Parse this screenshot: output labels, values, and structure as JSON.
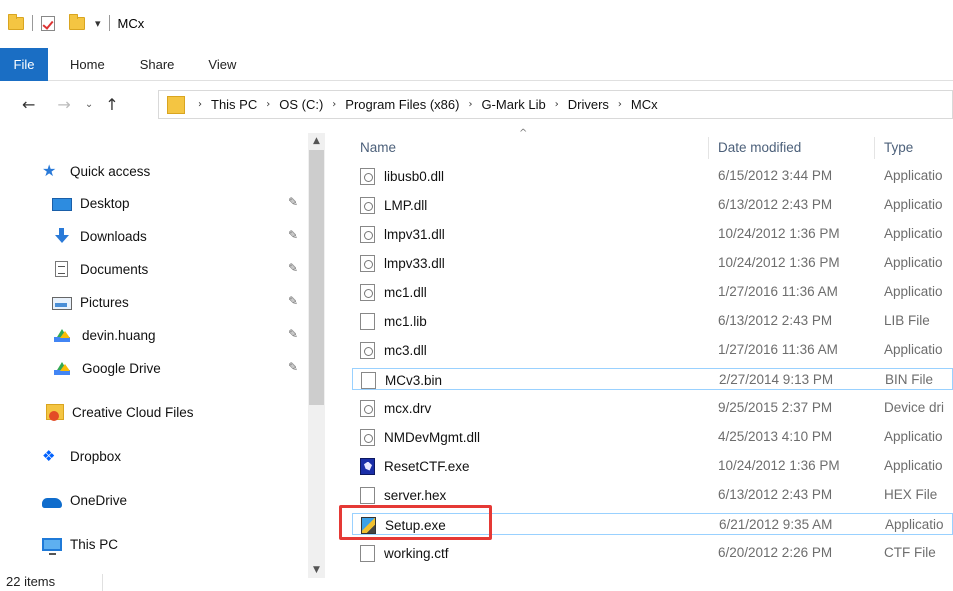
{
  "window": {
    "title": "MCx"
  },
  "quick_access": {
    "dropdown_glyph": "▾"
  },
  "ribbon": {
    "tabs": [
      {
        "label": "File",
        "active": true
      },
      {
        "label": "Home"
      },
      {
        "label": "Share"
      },
      {
        "label": "View"
      }
    ]
  },
  "navigation": {
    "back_glyph": "←",
    "forward_glyph": "→",
    "recent_glyph": "⌄",
    "up_glyph": "↑",
    "breadcrumb": [
      "This PC",
      "OS (C:)",
      "Program Files (x86)",
      "G-Mark Lib",
      "Drivers",
      "MCx"
    ],
    "separator": "›"
  },
  "nav_pane": {
    "items": [
      {
        "label": "Quick access",
        "icon": "star-icon"
      },
      {
        "label": "Desktop",
        "icon": "desktop-icon",
        "pinned": true
      },
      {
        "label": "Downloads",
        "icon": "downloads-icon",
        "pinned": true
      },
      {
        "label": "Documents",
        "icon": "documents-icon",
        "pinned": true
      },
      {
        "label": "Pictures",
        "icon": "pictures-icon",
        "pinned": true
      },
      {
        "label": "devin.huang",
        "icon": "google-drive-icon",
        "pinned": true
      },
      {
        "label": "Google Drive",
        "icon": "google-drive-icon",
        "pinned": true
      },
      {
        "label": "Creative Cloud Files",
        "icon": "creative-cloud-icon"
      },
      {
        "label": "Dropbox",
        "icon": "dropbox-icon"
      },
      {
        "label": "OneDrive",
        "icon": "onedrive-icon"
      },
      {
        "label": "This PC",
        "icon": "this-pc-icon"
      }
    ],
    "pin_glyph": "✎"
  },
  "file_list": {
    "columns": {
      "name": "Name",
      "date": "Date modified",
      "type": "Type"
    },
    "sort_glyph": "^",
    "files": [
      {
        "name": "libusb0.dll",
        "date": "6/15/2012 3:44 PM",
        "type": "Applicatio",
        "icon": "dll-icon"
      },
      {
        "name": "LMP.dll",
        "date": "6/13/2012 2:43 PM",
        "type": "Applicatio",
        "icon": "dll-icon"
      },
      {
        "name": "lmpv31.dll",
        "date": "10/24/2012 1:36 PM",
        "type": "Applicatio",
        "icon": "dll-icon"
      },
      {
        "name": "lmpv33.dll",
        "date": "10/24/2012 1:36 PM",
        "type": "Applicatio",
        "icon": "dll-icon"
      },
      {
        "name": "mc1.dll",
        "date": "1/27/2016 11:36 AM",
        "type": "Applicatio",
        "icon": "dll-icon"
      },
      {
        "name": "mc1.lib",
        "date": "6/13/2012 2:43 PM",
        "type": "LIB File",
        "icon": "file-icon"
      },
      {
        "name": "mc3.dll",
        "date": "1/27/2016 11:36 AM",
        "type": "Applicatio",
        "icon": "dll-icon"
      },
      {
        "name": "MCv3.bin",
        "date": "2/27/2014 9:13 PM",
        "type": "BIN File",
        "icon": "file-icon",
        "selected": true
      },
      {
        "name": "mcx.drv",
        "date": "9/25/2015 2:37 PM",
        "type": "Device dri",
        "icon": "dll-icon"
      },
      {
        "name": "NMDevMgmt.dll",
        "date": "4/25/2013 4:10 PM",
        "type": "Applicatio",
        "icon": "dll-icon"
      },
      {
        "name": "ResetCTF.exe",
        "date": "10/24/2012 1:36 PM",
        "type": "Applicatio",
        "icon": "reset-exe-icon"
      },
      {
        "name": "server.hex",
        "date": "6/13/2012 2:43 PM",
        "type": "HEX File",
        "icon": "file-icon"
      },
      {
        "name": "Setup.exe",
        "date": "6/21/2012 9:35 AM",
        "type": "Applicatio",
        "icon": "setup-exe-icon",
        "selected": true
      },
      {
        "name": "working.ctf",
        "date": "6/20/2012 2:26 PM",
        "type": "CTF File",
        "icon": "file-icon"
      }
    ]
  },
  "status_bar": {
    "item_count": "22 items"
  },
  "colors": {
    "accent": "#1a6ec4",
    "highlight_box": "#e53935",
    "selection_border": "#99d1ff"
  }
}
